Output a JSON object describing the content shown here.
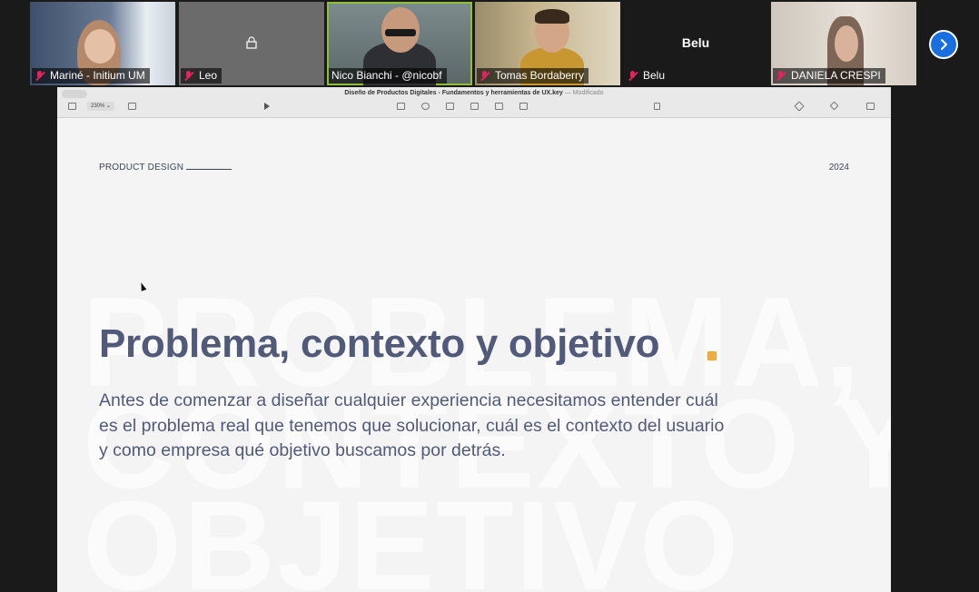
{
  "participants": [
    {
      "name": "Mariné - Initium UM",
      "muted": true
    },
    {
      "name": "Leo",
      "muted": true
    },
    {
      "name": "Nico Bianchi - @nicobf",
      "muted": false,
      "active": true
    },
    {
      "name": "Tomas Bordaberry",
      "muted": true
    },
    {
      "name": "Belu",
      "muted": true,
      "video_off_label": "Belu"
    },
    {
      "name": "DANIELA CRESPI",
      "muted": true
    }
  ],
  "next_page_icon": "chevron-right-icon",
  "keynote": {
    "window_title": "Diseño de Productos Digitales - Fundamentos y herramientas de UX.key",
    "window_status": "— Modificado",
    "zoom": "230%"
  },
  "slide": {
    "header_label": "PRODUCT DESIGN",
    "year": "2024",
    "watermark": "PROBLEMA,\nCONTEXTO Y\nOBJETIVO",
    "title": "Problema, contexto y objetivo",
    "body": "Antes de comenzar a diseñar cualquier experiencia necesitamos entender cuál es el problema real que tenemos que solucionar, cuál es el contexto del usuario y como empresa qué objetivo buscamos por detrás.",
    "accent_color": "#f3a93c"
  },
  "colors": {
    "active_speaker": "#8fbf3a",
    "muted": "#e0245e",
    "next_button": "#1a6fe0"
  }
}
